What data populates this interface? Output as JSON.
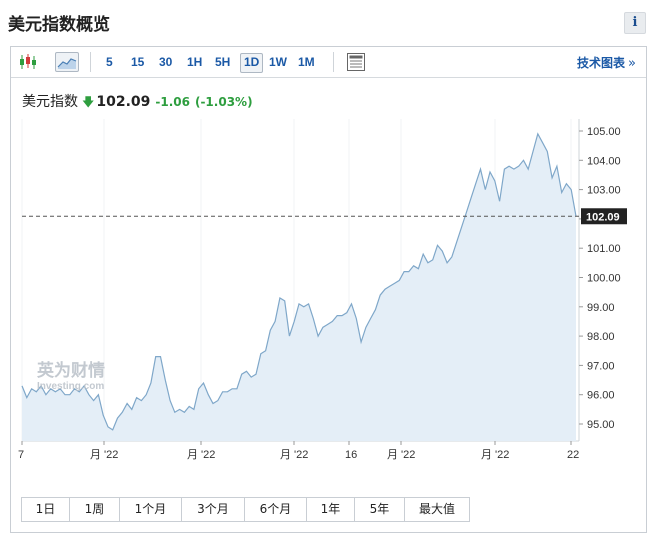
{
  "header": {
    "title": "美元指数概览",
    "info_label": "i"
  },
  "toolbar": {
    "timeframes": [
      "5",
      "15",
      "30",
      "1H",
      "5H",
      "1D",
      "1W",
      "1M"
    ],
    "active_timeframe": "1D",
    "tech_chart_label": "技术图表",
    "tech_chart_arrow": "»"
  },
  "quote": {
    "name": "美元指数",
    "direction_icon": "arrow-down-icon",
    "price": "102.09",
    "change": "-1.06",
    "change_pct": "(-1.03%)",
    "color_down": "#2e9e3f"
  },
  "watermark": {
    "cn": "英为财情",
    "en": "Investing.com"
  },
  "range_buttons": [
    "1日",
    "1周",
    "1个月",
    "3个月",
    "6个月",
    "1年",
    "5年",
    "最大值"
  ],
  "chart_data": {
    "type": "area",
    "y_ticks": [
      "105.00",
      "104.00",
      "103.00",
      "102.00",
      "101.00",
      "100.00",
      "99.00",
      "98.00",
      "97.00",
      "96.00",
      "95.00"
    ],
    "x_ticks": [
      "7",
      "月 '22",
      "月 '22",
      "月 '22",
      "16",
      "月 '22",
      "月 '22",
      "22"
    ],
    "ylim": [
      94.5,
      105.3
    ],
    "current_value": 102.09,
    "current_label": "102.09",
    "line_color": "#7fa7c9",
    "fill_color": "#e4eef7",
    "values": [
      96.3,
      95.9,
      96.2,
      96.1,
      96.3,
      96.0,
      96.2,
      96.1,
      96.2,
      96.0,
      96.0,
      96.2,
      96.1,
      96.3,
      96.0,
      95.8,
      96.0,
      95.3,
      94.9,
      94.8,
      95.2,
      95.4,
      95.7,
      95.5,
      95.9,
      95.8,
      96.0,
      96.4,
      97.3,
      97.3,
      96.5,
      95.8,
      95.4,
      95.5,
      95.4,
      95.6,
      95.5,
      96.2,
      96.4,
      96.0,
      95.7,
      95.8,
      96.1,
      96.1,
      96.2,
      96.2,
      96.7,
      96.8,
      96.6,
      96.7,
      97.4,
      97.5,
      98.2,
      98.5,
      99.3,
      99.2,
      98.0,
      98.5,
      99.1,
      99.0,
      99.1,
      98.6,
      98.0,
      98.3,
      98.4,
      98.5,
      98.7,
      98.7,
      98.8,
      99.1,
      98.6,
      97.8,
      98.3,
      98.6,
      98.9,
      99.4,
      99.6,
      99.7,
      99.8,
      99.9,
      100.2,
      100.2,
      100.4,
      100.3,
      100.8,
      100.5,
      100.6,
      101.1,
      100.9,
      100.5,
      100.7,
      101.2,
      101.7,
      102.2,
      102.7,
      103.2,
      103.7,
      103.0,
      103.6,
      103.3,
      102.6,
      103.7,
      103.8,
      103.7,
      103.8,
      104.0,
      103.7,
      104.3,
      104.9,
      104.6,
      104.3,
      103.4,
      103.8,
      102.9,
      103.2,
      103.0,
      102.09
    ]
  }
}
